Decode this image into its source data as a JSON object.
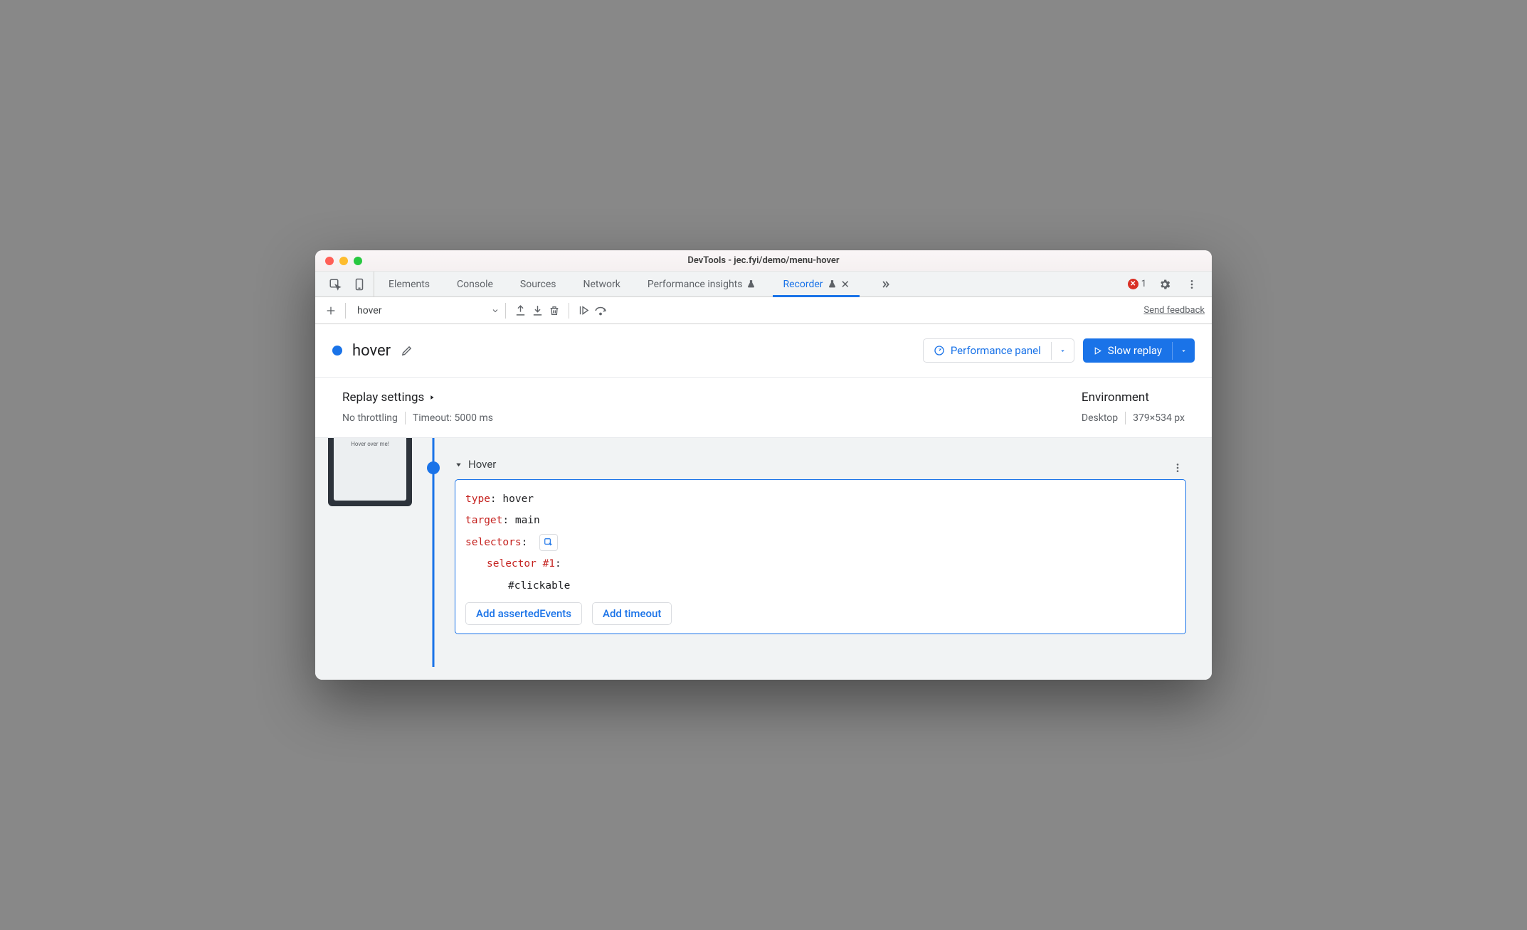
{
  "window": {
    "title": "DevTools - jec.fyi/demo/menu-hover"
  },
  "tabs": {
    "elements": "Elements",
    "console": "Console",
    "sources": "Sources",
    "network": "Network",
    "perf_insights": "Performance insights",
    "recorder": "Recorder"
  },
  "errors": {
    "count": "1"
  },
  "toolbar": {
    "recording_name": "hover",
    "feedback": "Send feedback"
  },
  "header": {
    "name": "hover",
    "perf_panel": "Performance panel",
    "slow_replay": "Slow replay"
  },
  "settings": {
    "replay_title": "Replay settings",
    "throttling": "No throttling",
    "timeout": "Timeout: 5000 ms",
    "env_title": "Environment",
    "device": "Desktop",
    "dimensions": "379×534 px"
  },
  "thumb": {
    "text": "Hover over me!"
  },
  "step": {
    "title": "Hover",
    "type_k": "type",
    "type_v": ": hover",
    "target_k": "target",
    "target_v": ": main",
    "selectors_k": "selectors",
    "selectors_v": ":",
    "sel1_k": "selector #1",
    "sel1_v": ":",
    "sel1_value": "#clickable",
    "add_asserted": "Add assertedEvents",
    "add_timeout": "Add timeout"
  }
}
